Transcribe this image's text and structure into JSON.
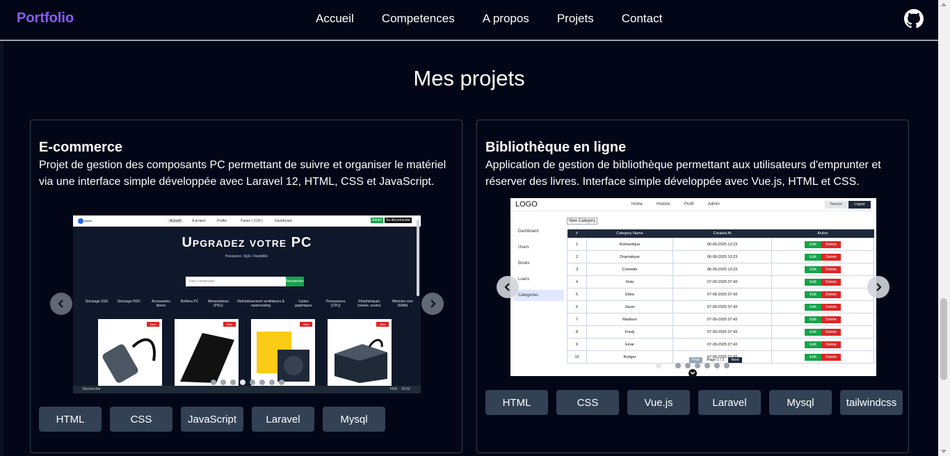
{
  "brand": "Portfolio",
  "nav": [
    "Accueil",
    "Competences",
    "A propos",
    "Projets",
    "Contact"
  ],
  "section_title": "Mes projets",
  "projects": [
    {
      "title": "E-commerce",
      "description": "Projet de gestion des composants PC permettant de suivre et organiser le matériel via une interface simple développée avec Laravel 12, HTML, CSS et JavaScript.",
      "tags": [
        "HTML",
        "CSS",
        "JavaScript",
        "Laravel",
        "Mysql"
      ],
      "screenshot": {
        "hero_title": "Upgradez votre PC",
        "hero_subtitle": "Puissance. Style. Flexibilité.",
        "search_placeholder": "Votre composant",
        "search_button": "Rechercher",
        "header_links": [
          "Accueil",
          "A propos",
          "Profile",
          "Panier ( 0,00 )",
          "Dashboard"
        ],
        "header_buttons": [
          "Admin",
          "Se déconnecter"
        ],
        "categories": [
          "Stockage SSD",
          "Stockage HDD",
          "Accessoires divers",
          "Boîtiers PC",
          "Alimentations (PSU)",
          "Refroidissement ventilateurs & watercooling",
          "Cartes graphiques",
          "Processeurs (CPU)",
          "Périphériques (clavier, souris)",
          "Mémoire vive (RAM)"
        ],
        "badge": "New",
        "taskbar_search": "Rechercher",
        "taskbar_lang": "FRA",
        "taskbar_time": "20:52",
        "dots_count": 8,
        "active_dot": 3
      }
    },
    {
      "title": "Bibliothèque en ligne",
      "description": "Application de gestion de bibliothèque permettant aux utilisateurs d'emprunter et réserver des livres. Interface simple développée avec Vue.js, HTML et CSS.",
      "tags": [
        "HTML",
        "CSS",
        "Vue.js",
        "Laravel",
        "Mysql",
        "tailwindcss"
      ],
      "screenshot": {
        "logo": "LOGO",
        "nav": [
          "Home",
          "Historic",
          "Profil",
          "Admin"
        ],
        "user": "Terence",
        "logout": "Logout",
        "sidebar": [
          "Dashboard",
          "Users",
          "Books",
          "Loans",
          "Categories"
        ],
        "new_button": "New Category",
        "columns": [
          "#",
          "Category Name",
          "Created At",
          "Action"
        ],
        "rows": [
          [
            "1",
            "Romantique",
            "06-09-2025 13:23"
          ],
          [
            "2",
            "Dramatique",
            "06-09-2025 13:23"
          ],
          [
            "3",
            "Comedie",
            "06-09-2025 13:23"
          ],
          [
            "4",
            "Nola",
            "07-09-2025 07:43"
          ],
          [
            "5",
            "Ebba",
            "07-09-2025 07:43"
          ],
          [
            "6",
            "Jason",
            "07-09-2025 07:43"
          ],
          [
            "7",
            "Madison",
            "07-09-2025 07:43"
          ],
          [
            "8",
            "Fredy",
            "07-09-2025 07:43"
          ],
          [
            "9",
            "Einar",
            "07-09-2025 07:43"
          ],
          [
            "10",
            "Rodger",
            "07-09-2025 07:43"
          ]
        ],
        "edit": "Edit",
        "delete": "Delete",
        "prev": "Prev",
        "page": "Page 1 / 2",
        "next": "Next",
        "dots_count": 8,
        "active_dot": 0
      }
    }
  ],
  "colors": {
    "brand": "#8b5cf6",
    "background": "#020617",
    "tag": "#334155",
    "card_border": "#334155"
  }
}
